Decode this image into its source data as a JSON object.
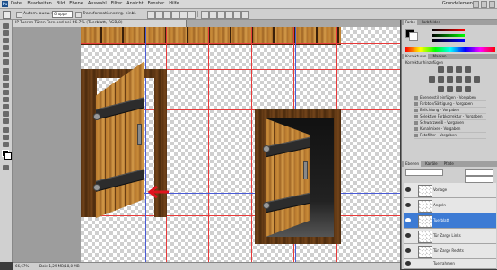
{
  "menu": {
    "app_icon": "photoshop-logo",
    "items": [
      "Datei",
      "Bearbeiten",
      "Bild",
      "Ebene",
      "Auswahl",
      "Filter",
      "Ansicht",
      "Fenster",
      "Hilfe"
    ],
    "workspace": "Grundelemente"
  },
  "options_bar": {
    "tool_icon": "move-tool-icon",
    "auto_select_label": "Autom. ausw.:",
    "auto_select_value": "Gruppe",
    "transform_label": "Transformationsstrg. einbl."
  },
  "document": {
    "tab_title": "IP-Tueren-Türen-Tore.psd bei 66.7% (Tuerblatt, RGB/8)",
    "zoom": "66,67%",
    "doc_size": "Dok: 1,29 MB/18,0 MB"
  },
  "panels": {
    "color_tabs": [
      "Farbe",
      "Farbfelder"
    ],
    "adjust_tabs": [
      "Korrekturen",
      "Masken"
    ],
    "adjust_title": "Korrektur hinzufügen",
    "history": [
      "Ebenenstil einfügen - Vorgaben",
      "Farbton/Sättigung - Vorgaben",
      "Belichtung - Vorgaben",
      "Selektive Farbkorrektur - Vorgaben",
      "Schwarzweiß - Vorgaben",
      "Kanalmixer - Vorgaben",
      "Fotofilter - Vorgaben"
    ],
    "layers_tabs": [
      "Ebenen",
      "Kanäle",
      "Pfade"
    ],
    "layers": [
      {
        "name": "Vorlage",
        "selected": false
      },
      {
        "name": "Angeln",
        "selected": false
      },
      {
        "name": "Tuerblatt",
        "selected": true
      },
      {
        "name": "Tür Zarge Links",
        "selected": false
      },
      {
        "name": "Tür Zarge Rechts",
        "selected": false
      },
      {
        "name": "Tuerrahmen",
        "selected": false
      }
    ]
  },
  "colors": {
    "guide_red": "#e83a3a",
    "guide_blue": "#4a5bd6",
    "arrow_red": "#e0141e",
    "selected_layer": "#3d7bd4"
  }
}
